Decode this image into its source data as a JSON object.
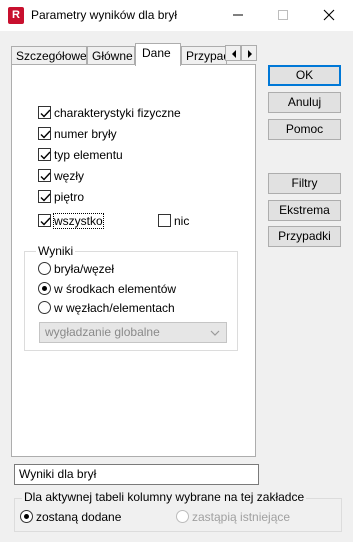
{
  "window": {
    "title": "Parametry wyników dla brył",
    "app_icon_letter": "R"
  },
  "tabs": [
    {
      "label": "Szczegółowe",
      "active": false
    },
    {
      "label": "Główne",
      "active": false
    },
    {
      "label": "Dane",
      "active": true
    },
    {
      "label": "Przypadki",
      "active": false
    }
  ],
  "checkboxes": [
    {
      "label": "charakterystyki fizyczne",
      "checked": true
    },
    {
      "label": "numer bryły",
      "checked": true
    },
    {
      "label": "typ elementu",
      "checked": true
    },
    {
      "label": "węzły",
      "checked": true
    },
    {
      "label": "piętro",
      "checked": true
    },
    {
      "label": "wszystko",
      "checked": true
    }
  ],
  "nic_checkbox": {
    "label": "nic",
    "checked": false
  },
  "results_group": {
    "title": "Wyniki",
    "options": [
      {
        "label": "bryła/węzeł",
        "selected": false
      },
      {
        "label": "w środkach elementów",
        "selected": true
      },
      {
        "label": "w węzłach/elementach",
        "selected": false
      }
    ],
    "smoothing_select": {
      "value": "wygładzanie globalne",
      "enabled": false
    }
  },
  "buttons": {
    "ok": "OK",
    "cancel": "Anuluj",
    "help": "Pomoc",
    "filters": "Filtry",
    "extremes": "Ekstrema",
    "cases": "Przypadki"
  },
  "table_name_field": {
    "value": "Wyniki dla brył"
  },
  "columns_group": {
    "title": "Dla aktywnej tabeli kolumny wybrane na tej zakładce",
    "options": [
      {
        "label": "zostaną dodane",
        "selected": true,
        "enabled": true
      },
      {
        "label": "zastąpią istniejące",
        "selected": false,
        "enabled": false
      }
    ]
  },
  "colors": {
    "accent": "#0078d7",
    "app_icon": "#c8102e"
  }
}
